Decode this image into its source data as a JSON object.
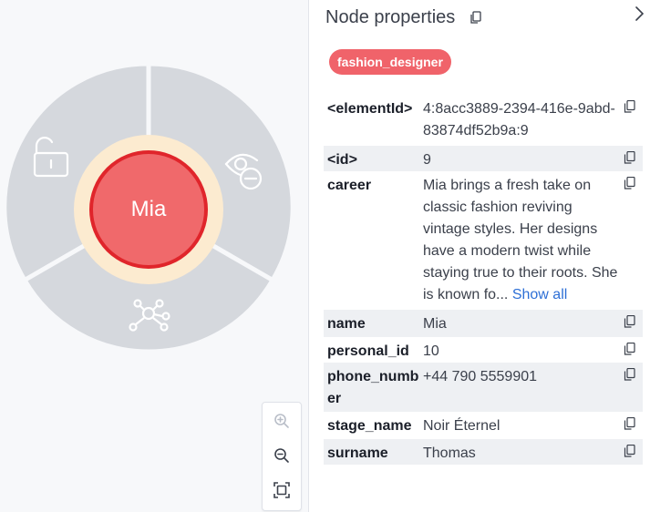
{
  "node": {
    "caption": "Mia",
    "ring_actions": [
      "unlock-icon",
      "hide-icon",
      "expand-relationships-icon"
    ]
  },
  "zoom_controls": [
    "zoom-in-icon",
    "zoom-out-icon",
    "fit-to-screen-icon"
  ],
  "panel": {
    "title": "Node properties",
    "label": "fashion_designer",
    "properties": [
      {
        "key": "<elementId>",
        "value": "4:8acc3889-2394-416e-9abd-83874df52b9a:9"
      },
      {
        "key": "<id>",
        "value": "9"
      },
      {
        "key": "career",
        "value": "Mia brings a fresh take on classic fashion reviving vintage styles. Her designs have a modern twist while staying true to their roots. She is known fo...",
        "link": "Show all"
      },
      {
        "key": "name",
        "value": "Mia"
      },
      {
        "key": "personal_id",
        "value": "10"
      },
      {
        "key": "phone_number",
        "value": "+44 790 5559901"
      },
      {
        "key": "stage_name",
        "value": "Noir Éternel"
      },
      {
        "key": "surname",
        "value": "Thomas"
      }
    ]
  },
  "colors": {
    "ring": "#d5d8dd",
    "halo": "#fcebd0",
    "node_fill": "#f0696b",
    "node_border": "#e0252b",
    "label_pill": "#f0636a",
    "link": "#2d6fd6"
  }
}
